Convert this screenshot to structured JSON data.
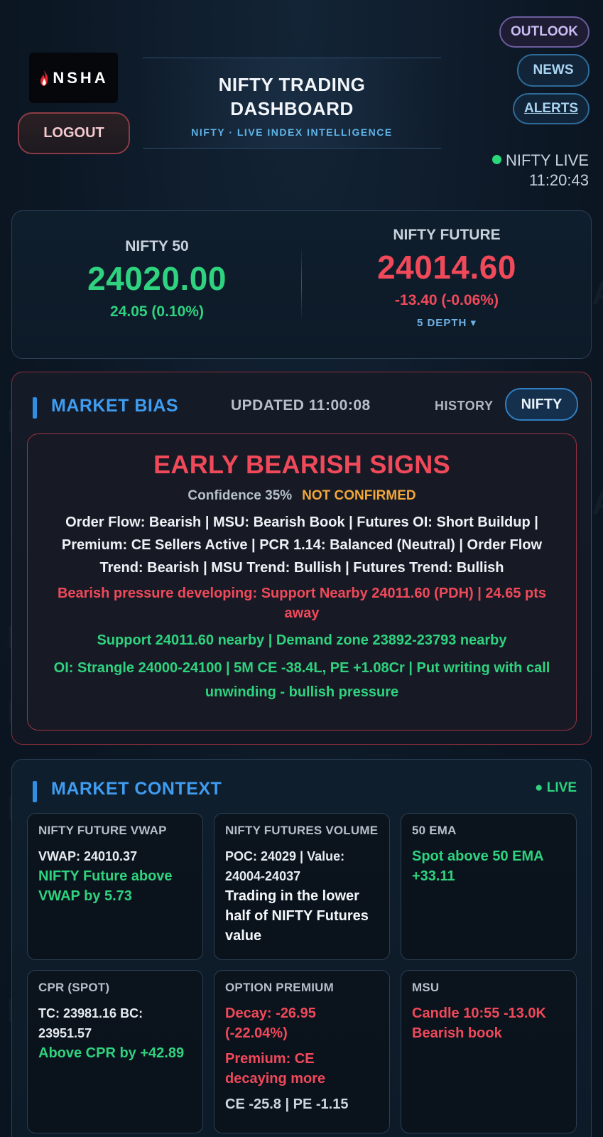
{
  "header": {
    "logo_text": "NSHA",
    "logout_label": "LOGOUT",
    "title": "NIFTY TRADING DASHBOARD",
    "subtitle": "NIFTY · LIVE INDEX INTELLIGENCE",
    "nav": {
      "outlook_label": "OUTLOOK",
      "news_label": "NEWS",
      "alerts_label": "ALERTS"
    },
    "live_label": "NIFTY LIVE",
    "live_time": "11:20:43"
  },
  "prices": {
    "spot": {
      "label": "NIFTY 50",
      "value": "24020.00",
      "change": "24.05 (0.10%)"
    },
    "future": {
      "label": "NIFTY FUTURE",
      "value": "24014.60",
      "change": "-13.40 (-0.06%)",
      "depth_label": "5 DEPTH ▾"
    }
  },
  "market_bias": {
    "title": "MARKET BIAS",
    "updated": "UPDATED 11:00:08",
    "history_label": "HISTORY",
    "instrument_label": "NIFTY",
    "headline": "EARLY BEARISH SIGNS",
    "confidence": "Confidence 35%",
    "status": "NOT CONFIRMED",
    "summary": "Order Flow: Bearish | MSU: Bearish Book | Futures OI: Short Buildup | Premium: CE Sellers Active | PCR 1.14: Balanced (Neutral) | Order Flow Trend: Bearish | MSU Trend: Bullish | Futures Trend: Bullish",
    "warning": "Bearish pressure developing: Support Nearby 24011.60 (PDH) | 24.65 pts away",
    "support": "Support 24011.60 nearby | Demand zone 23892-23793 nearby",
    "oi": "OI: Strangle 24000-24100 | 5M CE -38.4L, PE +1.08Cr | Put writing with call unwinding - bullish pressure"
  },
  "market_context": {
    "title": "MARKET CONTEXT",
    "live_label": "● LIVE",
    "tiles": [
      {
        "title": "NIFTY FUTURE VWAP",
        "line1": "VWAP: 24010.37",
        "line2": "NIFTY Future above VWAP by 5.73"
      },
      {
        "title": "NIFTY FUTURES VOLUME",
        "line1": "POC: 24029 | Value: 24004-24037",
        "line2": "Trading in the lower half of NIFTY Futures value"
      },
      {
        "title": "50 EMA",
        "line1": "Spot above 50 EMA +33.11"
      },
      {
        "title": "CPR (SPOT)",
        "line1": "TC: 23981.16 BC: 23951.57",
        "line2": "Above CPR by +42.89"
      },
      {
        "title": "OPTION PREMIUM",
        "line1": "Decay: -26.95 (-22.04%)",
        "line2": "Premium: CE decaying more",
        "line3": "CE -25.8 | PE -1.15"
      },
      {
        "title": "MSU",
        "line1": "Candle 10:55 -13.0K Bearish book"
      }
    ]
  },
  "colors": {
    "background": "#0c1724",
    "accent_blue": "#3f9cf0",
    "bullish_green": "#2fd27f",
    "bearish_red": "#f0495a",
    "warning_orange": "#f1a73a"
  },
  "icons": {
    "logo": "flame-logo-icon",
    "live_indicator": "live-dot-icon",
    "section_marker": "section-bar-icon"
  }
}
